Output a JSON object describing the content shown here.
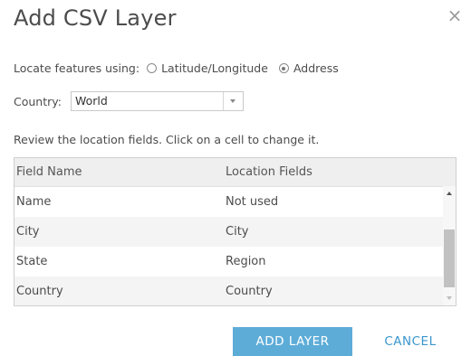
{
  "dialog": {
    "title": "Add CSV Layer",
    "close_glyph": "×"
  },
  "locate": {
    "label": "Locate features using:",
    "options": [
      {
        "label": "Latitude/Longitude",
        "checked": false
      },
      {
        "label": "Address",
        "checked": true
      }
    ]
  },
  "country": {
    "label": "Country:",
    "value": "World"
  },
  "review_text": "Review the location fields. Click on a cell to change it.",
  "table": {
    "headers": [
      "Field Name",
      "Location Fields"
    ],
    "rows": [
      [
        "Name",
        "Not used"
      ],
      [
        "City",
        "City"
      ],
      [
        "State",
        "Region"
      ],
      [
        "Country",
        "Country"
      ]
    ]
  },
  "buttons": {
    "add_layer": "ADD LAYER",
    "cancel": "CANCEL"
  },
  "colors": {
    "primary_button": "#5dacd8",
    "link": "#3a96cc"
  }
}
